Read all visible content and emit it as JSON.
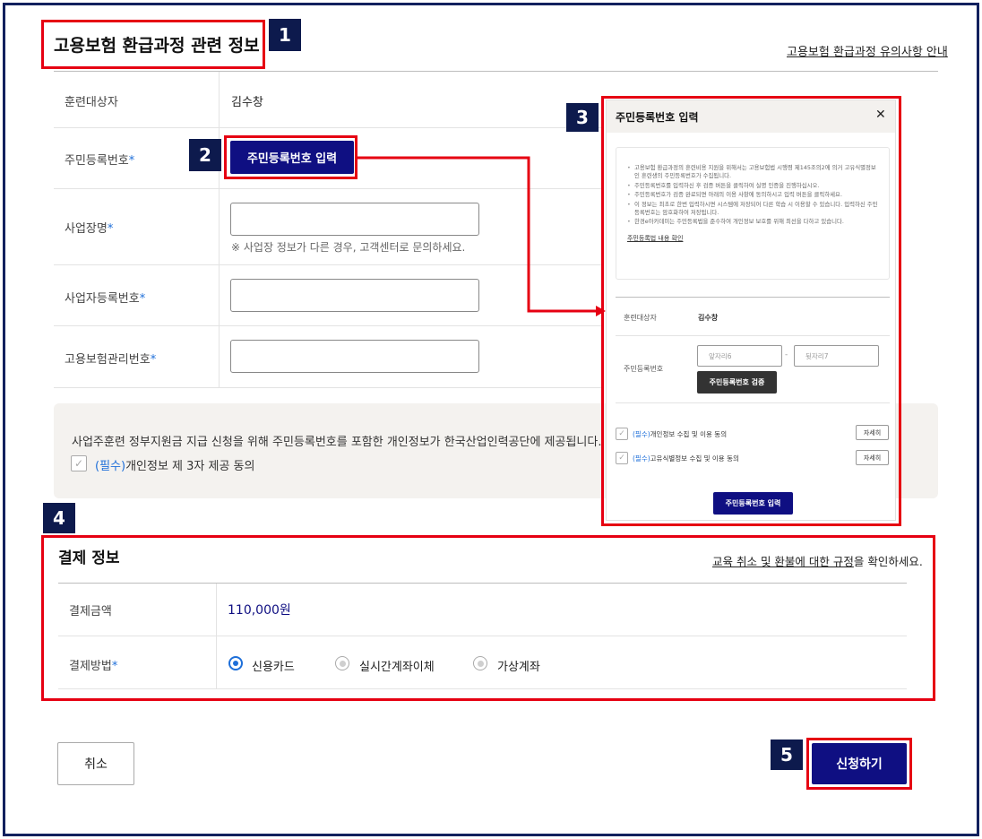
{
  "insurance_section": {
    "title": "고용보험 환급과정 관련 정보",
    "notice_link": "고용보험 환급과정 유의사항 안내",
    "rows": {
      "trainee_label": "훈련대상자",
      "trainee_value": "김수창",
      "rrn_label": "주민등록번호",
      "rrn_button": "주민등록번호 입력",
      "company_label": "사업장명",
      "company_hint": "※ 사업장 정보가 다른 경우, 고객센터로 문의하세요.",
      "bizno_label": "사업자등록번호",
      "insno_label": "고용보험관리번호",
      "required_mark": "*"
    },
    "consent_text": "사업주훈련 정부지원금 지급 신청을 위해 주민등록번호를 포함한 개인정보가 한국산업인력공단에 제공됩니다.",
    "consent_required": "(필수)",
    "consent_label": "개인정보 제 3자 제공 동의"
  },
  "modal": {
    "title": "주민등록번호 입력",
    "close_symbol": "✕",
    "notices": [
      "고용보험 환급과정의 훈련비용 지원을 위해서는 고용보험법 시행령 제145조의2에 의거 고유식별정보인 훈련생의 주민등록번호가 수집됩니다.",
      "주민등록번호를 입력하신 후 검증 버튼을 클릭하여 실명 인증을 진행하십시오.",
      "주민등록번호가 검증 완료되면 아래의 이용 사항에 동의하시고 입력 버튼을 클릭하세요.",
      "이 정보는 최초로 한번 입력하시면 시스템에 저장되어 다른 학습 시 이용할 수 있습니다. 입력하신 주민등록번호는 암호화하여 저장됩니다.",
      "한경e아카데미는 주민등록법을 준수하여 개인정보 보호를 위해 최선을 다하고 있습니다."
    ],
    "notice_link": "주민등록법 내용 확인",
    "trainee_label": "훈련대상자",
    "trainee_value": "김수창",
    "rrn_label": "주민등록번호",
    "front_placeholder": "앞자리6",
    "dash": "-",
    "back_placeholder": "뒷자리7",
    "verify_button": "주민등록번호 검증",
    "consent1_required": "(필수)",
    "consent1_label": "개인정보 수집 및 이용 동의",
    "consent2_required": "(필수)",
    "consent2_label": "고유식별정보 수집 및 이용 동의",
    "detail_button": "자세히",
    "submit_button": "주민등록번호 입력"
  },
  "payment": {
    "title": "결제 정보",
    "rule_link": "교육 취소 및 환불에 대한 규정",
    "rule_suffix": "을 확인하세요.",
    "amount_label": "결제금액",
    "amount_value": "110,000원",
    "method_label": "결제방법",
    "required_mark": "*",
    "methods": [
      "신용카드",
      "실시간계좌이체",
      "가상계좌"
    ],
    "selected_method": "신용카드"
  },
  "footer": {
    "cancel_button": "취소",
    "apply_button": "신청하기"
  },
  "annotations": [
    "1",
    "2",
    "3",
    "4",
    "5"
  ],
  "colors": {
    "highlight": "#e60012",
    "badge": "#0d1a4d",
    "primary": "#0f0f82",
    "required": "#1e6fd9"
  }
}
